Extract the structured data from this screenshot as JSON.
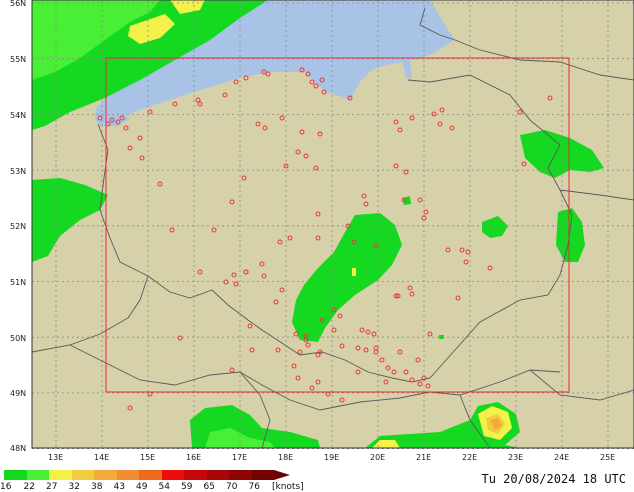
{
  "map": {
    "lat_labels": [
      "56N",
      "55N",
      "54N",
      "53N",
      "52N",
      "51N",
      "50N",
      "49N",
      "48N"
    ],
    "lon_labels": [
      "13E",
      "14E",
      "15E",
      "16E",
      "17E",
      "18E",
      "19E",
      "20E",
      "21E",
      "22E",
      "23E",
      "24E",
      "25E"
    ],
    "colors": {
      "land": "#d6d1a9",
      "sea": "#a9c3e7",
      "grid": "#8a8a8a",
      "border": "#5a5a5a",
      "domain_box": "#e23030",
      "station": "#e8383a"
    }
  },
  "legend": {
    "values": [
      "16",
      "22",
      "27",
      "32",
      "38",
      "43",
      "49",
      "54",
      "59",
      "65",
      "70",
      "76"
    ],
    "unit": "[knots]",
    "colors": [
      "#15d820",
      "#48ef35",
      "#f4f24a",
      "#f2cc40",
      "#f3aa3a",
      "#f28c30",
      "#ee6a1d",
      "#ec0c0c",
      "#c80808",
      "#a80606",
      "#8c0404",
      "#700202"
    ]
  },
  "timestamp": "Tu 20/08/2024 18 UTC"
}
